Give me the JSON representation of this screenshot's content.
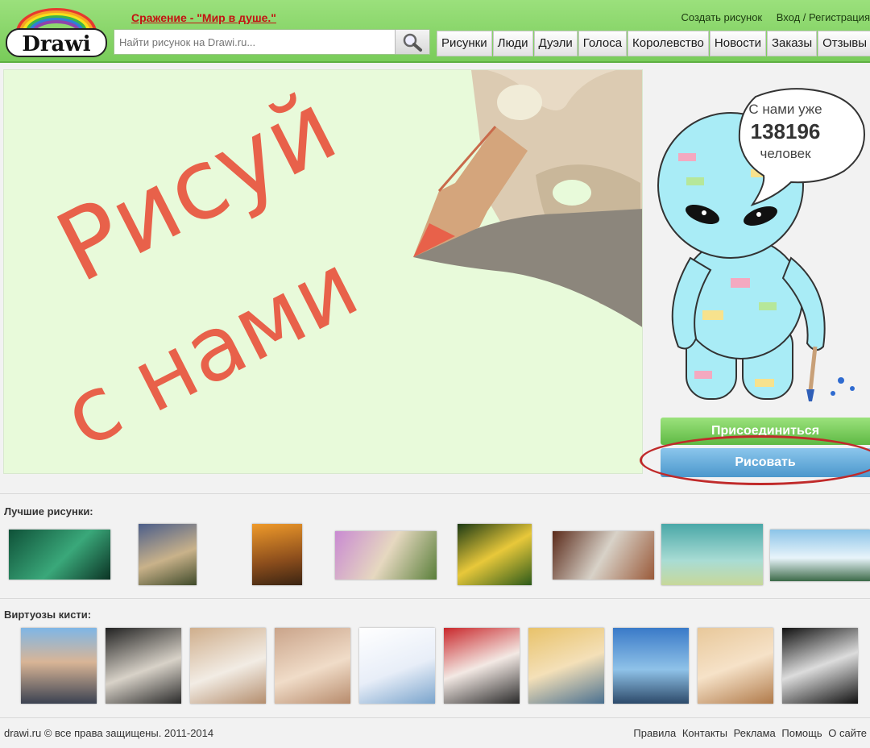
{
  "header": {
    "logo_text": "Drawi",
    "battle_link": "Сражение - \"Мир в душе.\"",
    "create_link": "Создать рисунок",
    "login_link": "Вход / Регистрация",
    "search": {
      "placeholder": "Найти рисунок на Drawi.ru..."
    },
    "nav": [
      "Рисунки",
      "Люди",
      "Дуэли",
      "Голоса",
      "Королевство",
      "Новости",
      "Заказы",
      "Отзывы"
    ]
  },
  "hero": {
    "slogan_line1": "Рисуй",
    "slogan_line2": "с нами"
  },
  "sidebar": {
    "bubble_line1": "С нами уже",
    "member_count": "138196",
    "bubble_line3": "человек",
    "join_button": "Присоединиться",
    "draw_button": "Рисовать"
  },
  "best_drawings": {
    "title": "Лучшие рисунки:"
  },
  "virtuosos": {
    "title": "Виртуозы кисти:"
  },
  "footer": {
    "copyright": "drawi.ru © все права защищены. 2011-2014",
    "links": [
      "Правила",
      "Контакты",
      "Реклама",
      "Помощь",
      "О сайте"
    ]
  },
  "colors": {
    "header_green": "#79cc5a",
    "battle_red": "#c41212",
    "join_green": "#5fb944",
    "draw_blue": "#4b97cc",
    "highlight_red": "#c02a2a",
    "hero_bg": "#e8fada",
    "slogan_orange": "#e8614a"
  }
}
